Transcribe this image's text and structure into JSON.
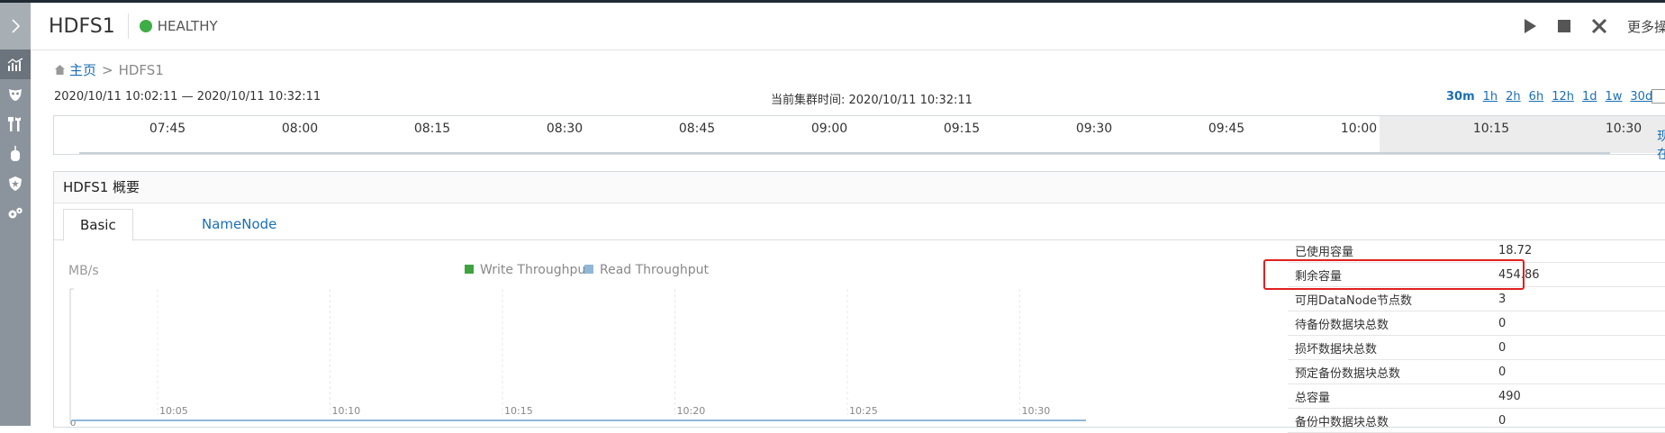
{
  "header": {
    "service_name": "HDFS1",
    "health_status": "HEALTHY",
    "more_label": "更多操作",
    "health_color": "#3fad46"
  },
  "nav_icons": [
    "chart-icon",
    "mask-icon",
    "tools-icon",
    "mouse-icon",
    "shield-icon",
    "gears-icon"
  ],
  "breadcrumb": {
    "home": "主页",
    "separator": ">",
    "current": "HDFS1"
  },
  "time_range": {
    "range_text": "2020/10/11 10:02:11 — 2020/10/11 10:32:11",
    "current_cluster_time": "当前集群时间: 2020/10/11 10:32:11",
    "options": [
      "30m",
      "1h",
      "2h",
      "6h",
      "12h",
      "1d",
      "1w",
      "30d"
    ],
    "selected": "30m"
  },
  "timeline": {
    "ticks": [
      "07:45",
      "08:00",
      "08:15",
      "08:30",
      "08:45",
      "09:00",
      "09:15",
      "09:30",
      "09:45",
      "10:00",
      "10:15",
      "10:30"
    ],
    "now_label": "现在"
  },
  "panel": {
    "title": "HDFS1 概要",
    "tabs": [
      "Basic",
      "NameNode"
    ],
    "active_tab": "Basic"
  },
  "chart_data": {
    "type": "line",
    "ylabel": "MB/s",
    "x": [
      "10:05",
      "10:10",
      "10:15",
      "10:20",
      "10:25",
      "10:30"
    ],
    "series": [
      {
        "name": "Write Throughput",
        "color": "#3fa33f",
        "values": [
          0,
          0,
          0,
          0,
          0,
          0
        ]
      },
      {
        "name": "Read Throughput",
        "color": "#8fb8d8",
        "values": [
          0,
          0,
          0,
          0,
          0,
          0
        ]
      }
    ],
    "y_tick_visible": "0",
    "grid": true,
    "legend": "top-center"
  },
  "metrics": [
    {
      "label": "已使用容量",
      "value": "18.72"
    },
    {
      "label": "剩余容量",
      "value": "454.86"
    },
    {
      "label": "可用DataNode节点数",
      "value": "3"
    },
    {
      "label": "待备份数据块总数",
      "value": "0"
    },
    {
      "label": "损坏数据块总数",
      "value": "0"
    },
    {
      "label": "预定备份数据块总数",
      "value": "0"
    },
    {
      "label": "总容量",
      "value": "490"
    },
    {
      "label": "备份中数据块总数",
      "value": "0"
    }
  ]
}
